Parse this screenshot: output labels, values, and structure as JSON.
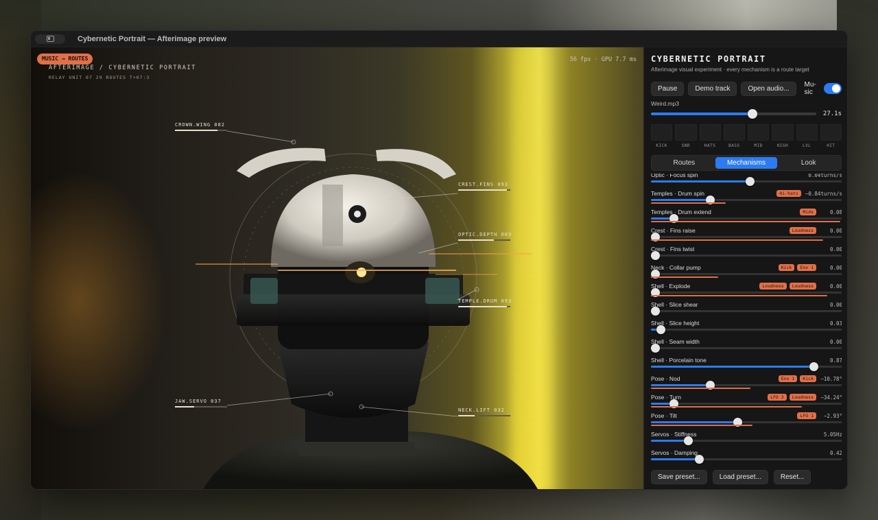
{
  "window": {
    "title": "Cybernetic Portrait — Afterimage preview"
  },
  "viewport": {
    "chip": "MUSIC → ROUTES",
    "title": "AFTERIMAGE / CYBERNETIC PORTRAIT",
    "subtitle": "RELAY UNIT 07   29 ROUTES   T+07:3",
    "stats": "56 fps · GPU 7.7 ms",
    "callouts": [
      {
        "label": "CROWN.WING 082",
        "level": 0.82
      },
      {
        "label": "CREST.FINS 093",
        "level": 0.93
      },
      {
        "label": "OPTIC.DEPTH 069",
        "level": 0.69
      },
      {
        "label": "TEMPLE.DRUM 093",
        "level": 0.93
      },
      {
        "label": "JAW.SERVO 037",
        "level": 0.37
      },
      {
        "label": "NECK.LIFT 032",
        "level": 0.32
      }
    ]
  },
  "panel": {
    "title": "CYBERNETIC PORTRAIT",
    "subtitle": "Afterimage visual experiment · every mechanism is a route target",
    "buttons": {
      "pause": "Pause",
      "demo": "Demo track",
      "open": "Open audio..."
    },
    "music_label": "Mu-sic",
    "music_on": true,
    "file": "Weird.mp3",
    "track": {
      "progress": 0.62,
      "time": "27.1s"
    },
    "meters": [
      "KICK",
      "SNR",
      "HATS",
      "BASS",
      "MID",
      "HIGH",
      "LVL",
      "HIT"
    ],
    "tabs": [
      {
        "label": "Routes",
        "active": false
      },
      {
        "label": "Mechanisms",
        "active": true
      },
      {
        "label": "Look",
        "active": false
      }
    ],
    "mechanisms": [
      {
        "name": "Optic · Focus spin",
        "tags": [],
        "value": "0.04turns/s",
        "level": 0.52,
        "mod": 0
      },
      {
        "name": "Temples · Drum spin",
        "tags": [
          "Hi-hats"
        ],
        "value": "−0.84turns/s",
        "level": 0.3,
        "mod": 0.39
      },
      {
        "name": "Temples · Drum extend",
        "tags": [
          "Mids"
        ],
        "value": "0.08",
        "level": 0.1,
        "mod": 0.99
      },
      {
        "name": "Crest · Fins raise",
        "tags": [
          "Loudness"
        ],
        "value": "0.00",
        "level": 0.0,
        "mod": 0.9
      },
      {
        "name": "Crest · Fins twist",
        "tags": [],
        "value": "0.00",
        "level": 0.0,
        "mod": 0
      },
      {
        "name": "Neck · Collar pump",
        "tags": [
          "Kick",
          "Env 1"
        ],
        "value": "0.00",
        "level": 0.0,
        "mod": 0.35
      },
      {
        "name": "Shell · Explode",
        "tags": [
          "Loudness",
          "Loudness"
        ],
        "value": "0.00",
        "level": 0.0,
        "mod": 0.92
      },
      {
        "name": "Shell · Slice shear",
        "tags": [],
        "value": "0.00",
        "level": 0.0,
        "mod": 0
      },
      {
        "name": "Shell · Slice height",
        "tags": [],
        "value": "0.03",
        "level": 0.03,
        "mod": 0
      },
      {
        "name": "Shell · Seam width",
        "tags": [],
        "value": "0.00",
        "level": 0.0,
        "mod": 0
      },
      {
        "name": "Shell · Porcelain tone",
        "tags": [],
        "value": "0.87",
        "level": 0.87,
        "mod": 0
      },
      {
        "name": "Pose · Nod",
        "tags": [
          "Env 1",
          "Kick"
        ],
        "value": "−10.78°",
        "level": 0.3,
        "mod": 0.52
      },
      {
        "name": "Pose · Turn",
        "tags": [
          "LFO 3",
          "Loudness"
        ],
        "value": "−34.24°",
        "level": 0.1,
        "mod": 0.79
      },
      {
        "name": "Pose · Tilt",
        "tags": [
          "LFO 1"
        ],
        "value": "−2.93°",
        "level": 0.45,
        "mod": 0.53
      },
      {
        "name": "Servos · Stiffness",
        "tags": [],
        "value": "5.05Hz",
        "level": 0.18,
        "mod": 0
      },
      {
        "name": "Servos · Damping",
        "tags": [],
        "value": "0.42",
        "level": 0.24,
        "mod": 0
      }
    ],
    "bottom": {
      "save": "Save preset...",
      "load": "Load preset...",
      "reset": "Reset..."
    }
  }
}
